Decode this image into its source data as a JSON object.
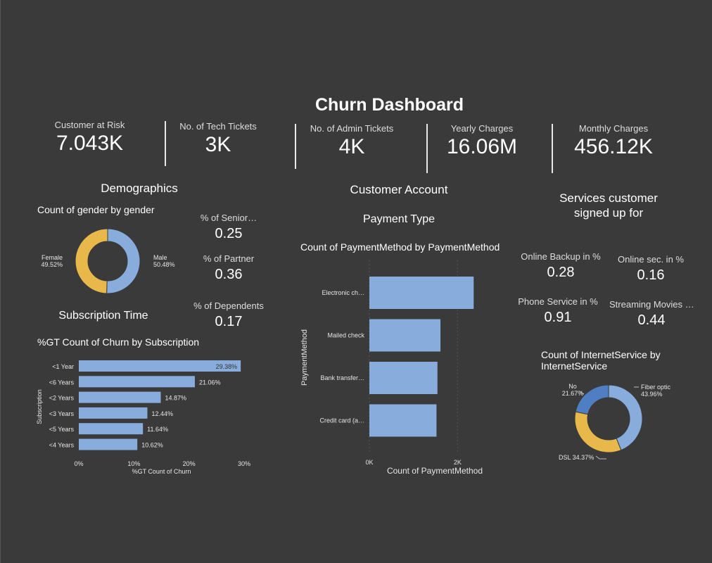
{
  "dashboard": {
    "title": "Churn Dashboard"
  },
  "kpis": [
    {
      "label": "Customer at Risk",
      "value": "7.043K"
    },
    {
      "label": "No. of Tech Tickets",
      "value": "3K"
    },
    {
      "label": "No. of Admin Tickets",
      "value": "4K"
    },
    {
      "label": "Yearly Charges",
      "value": "16.06M"
    },
    {
      "label": "Monthly Charges",
      "value": "456.12K"
    }
  ],
  "sections": {
    "demographics": "Demographics",
    "subscription_time": "Subscription Time",
    "customer_account": "Customer Account",
    "payment_type": "Payment Type",
    "services_line1": "Services customer",
    "services_line2": "signed up for"
  },
  "demographic_stats": [
    {
      "label": "% of Senior…",
      "value": "0.25"
    },
    {
      "label": "% of Partner",
      "value": "0.36"
    },
    {
      "label": "% of Dependents",
      "value": "0.17"
    }
  ],
  "service_stats": [
    {
      "label": "Online Backup in %",
      "value": "0.28"
    },
    {
      "label": "Online sec. in %",
      "value": "0.16"
    },
    {
      "label": "Phone Service in %",
      "value": "0.91"
    },
    {
      "label": "Streaming Movies …",
      "value": "0.44"
    }
  ],
  "colors": {
    "blue": "#88acdc",
    "yellow": "#e8b84a",
    "dark_blue": "#4f7ec3",
    "background": "#3a3a3a"
  },
  "chart_data": [
    {
      "type": "pie",
      "title": "Count of gender by gender",
      "donut": true,
      "slices": [
        {
          "label": "Male",
          "value": 50.48,
          "display": "50.48%",
          "color": "#88acdc"
        },
        {
          "label": "Female",
          "value": 49.52,
          "display": "49.52%",
          "color": "#e8b84a"
        }
      ]
    },
    {
      "type": "bar",
      "orientation": "horizontal",
      "title": "%GT Count of Churn by Subscription",
      "xlabel": "%GT Count of Churn",
      "ylabel": "Subscription",
      "categories": [
        "<1 Year",
        "<6 Years",
        "<2 Years",
        "<3 Years",
        "<5 Years",
        "<4 Years"
      ],
      "values": [
        29.38,
        21.06,
        14.87,
        12.44,
        11.64,
        10.62
      ],
      "data_labels": [
        "29.38%",
        "21.06%",
        "14.87%",
        "12.44%",
        "11.64%",
        "10.62%"
      ],
      "xlim": [
        0,
        30
      ],
      "xticks": [
        0,
        10,
        20,
        30
      ],
      "xtick_labels": [
        "0%",
        "10%",
        "20%",
        "30%"
      ]
    },
    {
      "type": "bar",
      "orientation": "horizontal",
      "title": "Count of PaymentMethod by PaymentMethod",
      "xlabel": "Count of PaymentMethod",
      "ylabel": "PaymentMethod",
      "categories": [
        "Electronic ch…",
        "Mailed check",
        "Bank transfer…",
        "Credit card (a…"
      ],
      "values": [
        2365,
        1612,
        1544,
        1522
      ],
      "xlim": [
        0,
        2600
      ],
      "xticks": [
        0,
        2000
      ],
      "xtick_labels": [
        "0K",
        "2K"
      ]
    },
    {
      "type": "pie",
      "title": "Count of InternetService by InternetService",
      "donut": true,
      "slices": [
        {
          "label": "Fiber optic",
          "value": 43.96,
          "display": "43.96%",
          "color": "#88acdc"
        },
        {
          "label": "DSL",
          "value": 34.37,
          "display": "34.37%",
          "color": "#e8b84a"
        },
        {
          "label": "No",
          "value": 21.67,
          "display": "21.67%",
          "color": "#4f7ec3"
        }
      ]
    }
  ]
}
